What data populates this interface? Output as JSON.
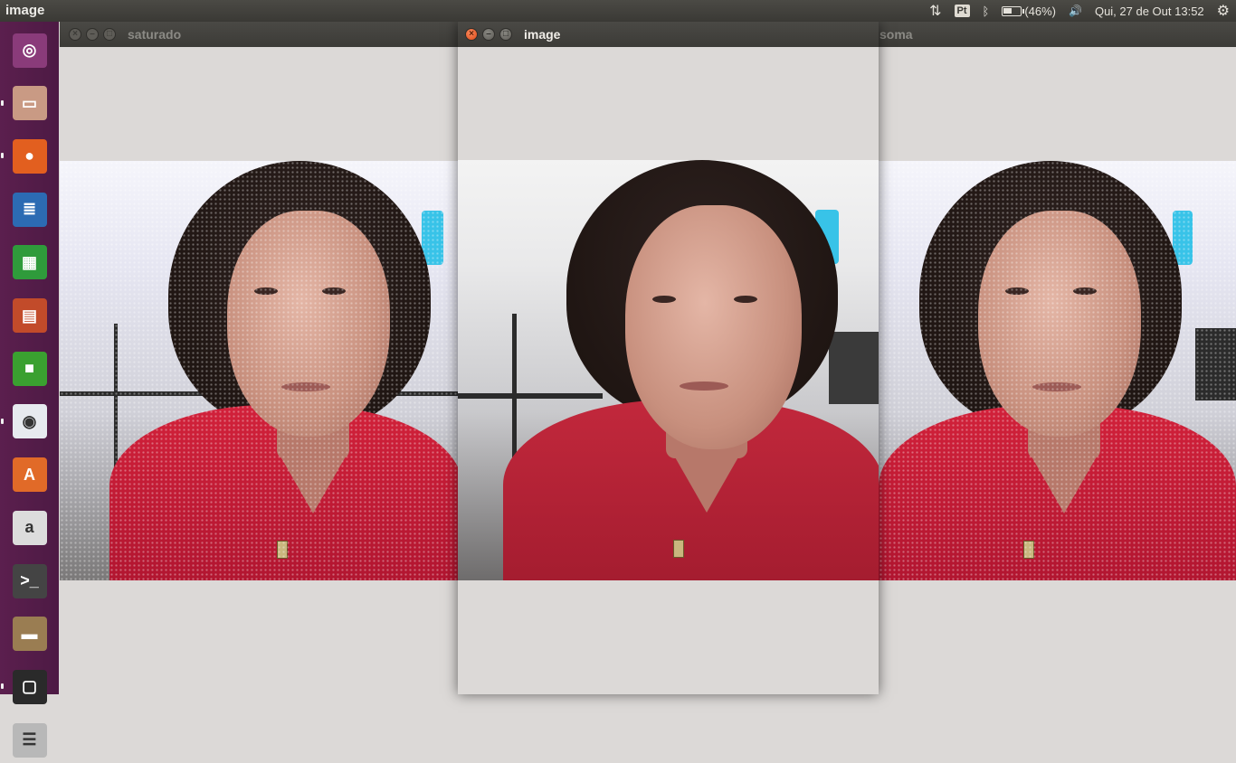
{
  "top_panel": {
    "app_title": "image",
    "keyboard_layout": "Pt",
    "battery_text": "(46%)",
    "battery_level": 0.46,
    "clock": "Qui, 27 de Out 13:52"
  },
  "launcher": {
    "items": [
      {
        "name": "ubuntu-dash",
        "icon": "ubuntu-logo-icon",
        "color": "#8a3b7a"
      },
      {
        "name": "files",
        "icon": "file-cabinet-icon",
        "color": "#c99a84"
      },
      {
        "name": "firefox",
        "icon": "firefox-icon",
        "color": "#e25f1f"
      },
      {
        "name": "writer",
        "icon": "document-icon",
        "color": "#2c6bb3"
      },
      {
        "name": "calc",
        "icon": "spreadsheet-icon",
        "color": "#2f9b3b"
      },
      {
        "name": "impress",
        "icon": "presentation-icon",
        "color": "#c24b2a"
      },
      {
        "name": "app-squares",
        "icon": "colored-squares-icon",
        "color": "#3aa030"
      },
      {
        "name": "chrome",
        "icon": "chrome-icon",
        "color": "#e7eaef"
      },
      {
        "name": "software-center",
        "icon": "shopping-bag-icon",
        "color": "#e16a28"
      },
      {
        "name": "amazon",
        "icon": "amazon-icon",
        "color": "#dcdcdc"
      },
      {
        "name": "terminal",
        "icon": "terminal-icon",
        "color": "#444"
      },
      {
        "name": "scanner",
        "icon": "scanner-icon",
        "color": "#9a7d52"
      },
      {
        "name": "window-1",
        "icon": "window-icon",
        "color": "#2a2a2a"
      },
      {
        "name": "window-stack",
        "icon": "window-stack-icon",
        "color": "#b8b8b8"
      }
    ]
  },
  "windows": {
    "saturado": {
      "title": "saturado"
    },
    "image": {
      "title": "image"
    },
    "soma": {
      "title": "soma"
    }
  },
  "icons": {
    "close": "×",
    "minimize": "–",
    "maximize": "□",
    "network": "⇅",
    "bluetooth": "ᛒ",
    "volume": "🔊",
    "settings": "⚙"
  },
  "colors": {
    "panel": "#3c3b37",
    "launcher": "#5b1f4e",
    "accent_close": "#df4a16",
    "canvas": "#dcd9d7"
  }
}
